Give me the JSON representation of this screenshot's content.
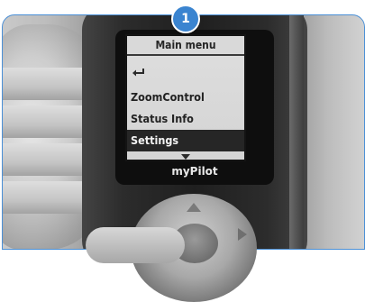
{
  "step_badge": "1",
  "screen": {
    "title": "Main menu",
    "back_icon": "return-arrow-icon",
    "items": [
      {
        "label": "ZoomControl",
        "selected": false
      },
      {
        "label": "Status Info",
        "selected": false
      },
      {
        "label": "Settings",
        "selected": true
      }
    ],
    "scroll_indicator": "triangle-down-icon"
  },
  "device": {
    "brand": "myPilot"
  },
  "colors": {
    "badge": "#3a84d0",
    "frame_border": "#4a8fd6",
    "selection": "#262626"
  }
}
